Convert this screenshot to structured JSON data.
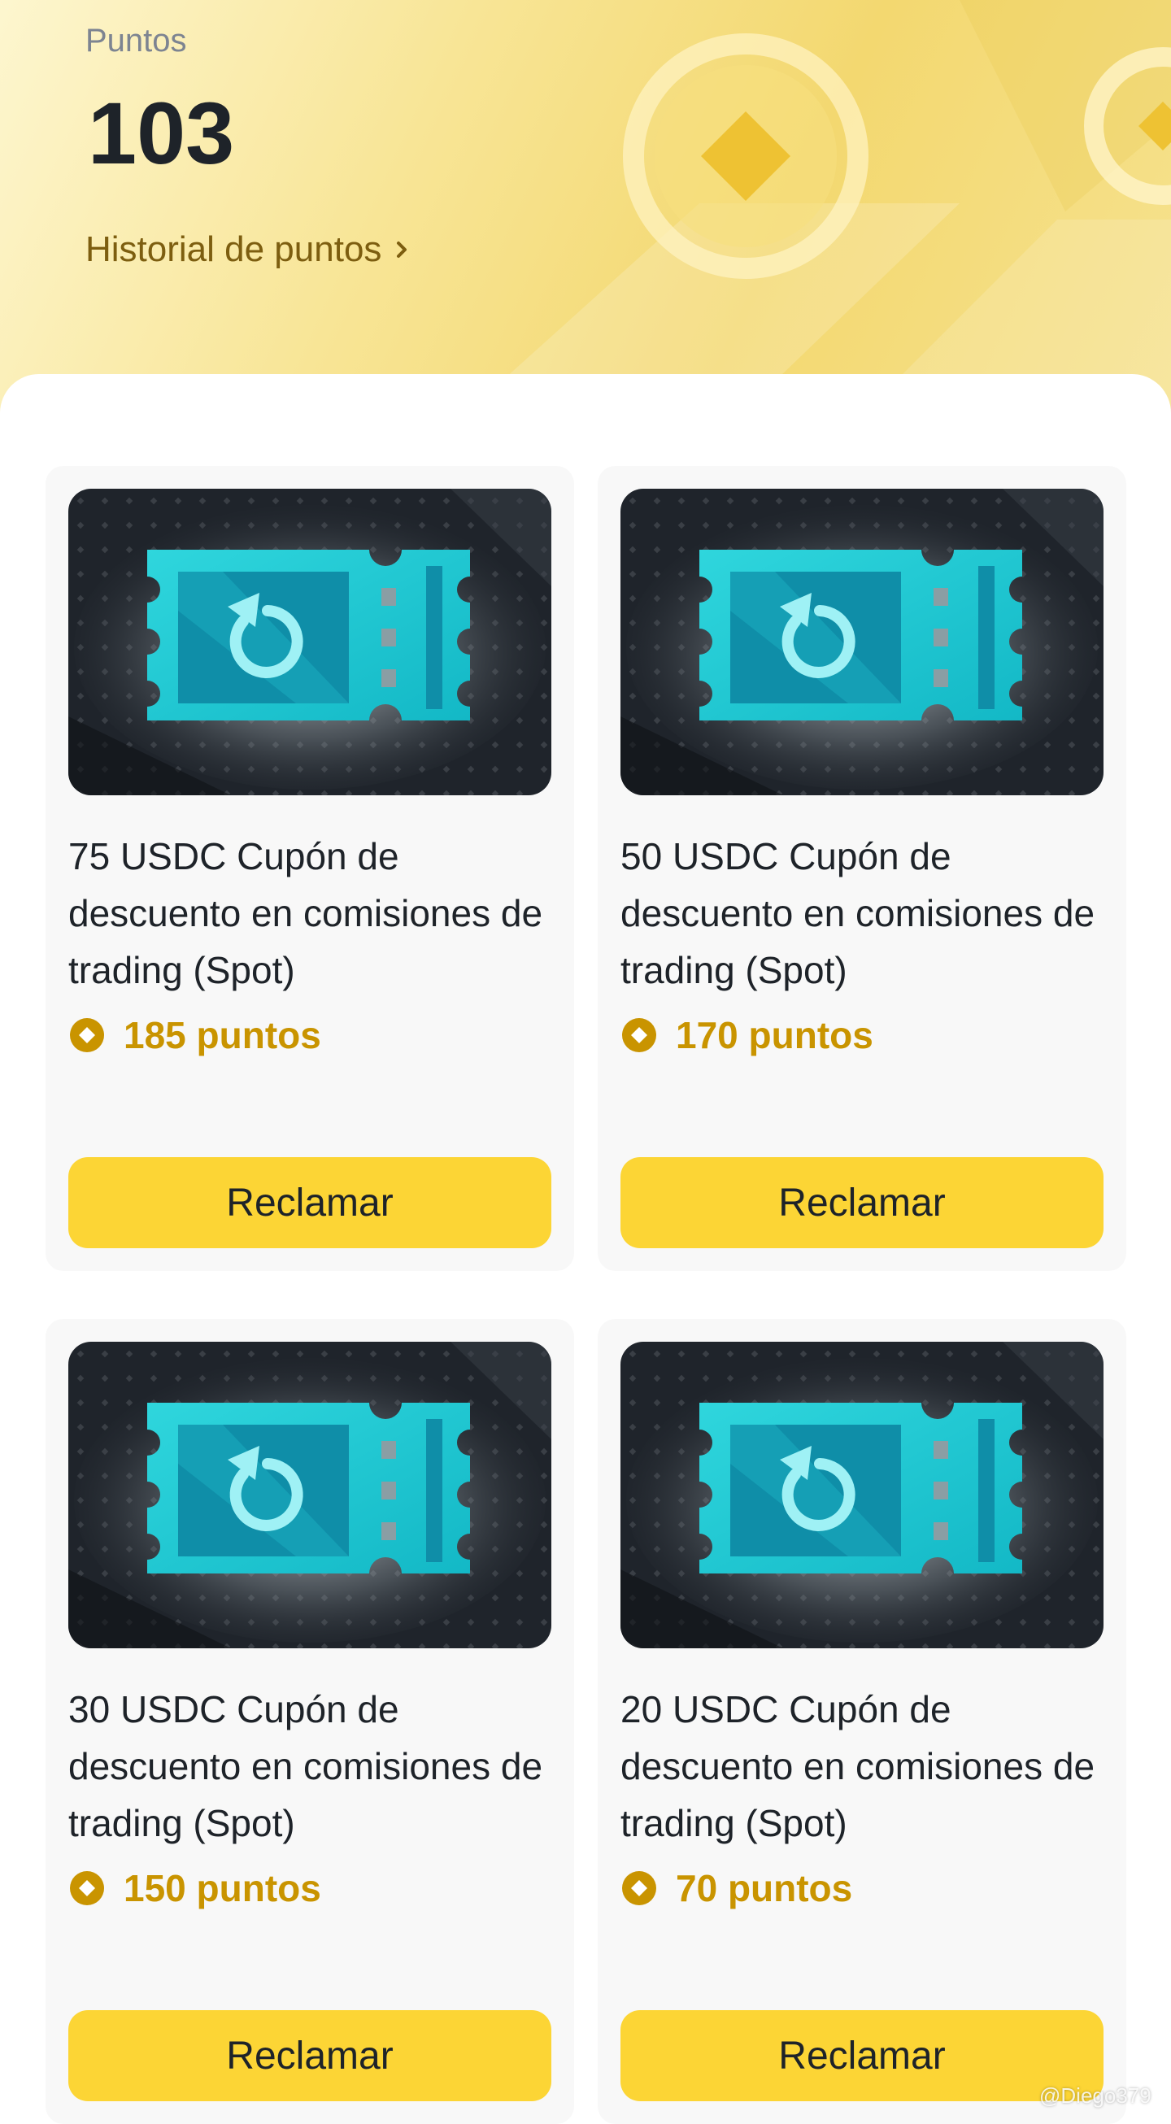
{
  "header": {
    "points_label": "Puntos",
    "points_value": "103",
    "history_link": "Historial de puntos"
  },
  "rewards": [
    {
      "title": "75 USDC Cupón de descuento en comisiones de trading (Spot)",
      "price": "185 puntos",
      "button": "Reclamar"
    },
    {
      "title": "50 USDC Cupón de descuento en comisiones de trading (Spot)",
      "price": "170 puntos",
      "button": "Reclamar"
    },
    {
      "title": "30 USDC Cupón de descuento en comisiones de trading (Spot)",
      "price": "150 puntos",
      "button": "Reclamar"
    },
    {
      "title": "20 USDC Cupón de descuento en comisiones de trading (Spot)",
      "price": "70 puntos",
      "button": "Reclamar"
    }
  ],
  "watermark": "@Diego379",
  "colors": {
    "accent": "#fcd535",
    "price": "#c99400",
    "text": "#1e2329",
    "ticket": "#22c7d0"
  },
  "icons": {
    "coupon": "coupon-ticket-icon",
    "points": "coin-icon",
    "chevron": "chevron-right-icon"
  }
}
